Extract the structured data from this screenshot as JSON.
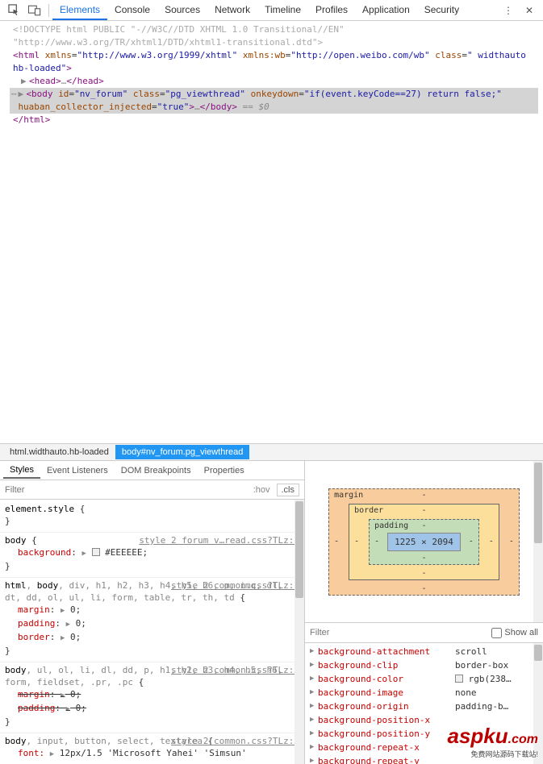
{
  "toolbar": {
    "tabs": [
      "Elements",
      "Console",
      "Sources",
      "Network",
      "Timeline",
      "Profiles",
      "Application",
      "Security"
    ],
    "active_tab": 0
  },
  "dom": {
    "doctype": "<!DOCTYPE html PUBLIC \"-//W3C//DTD XHTML 1.0 Transitional//EN\" \"http://www.w3.org/TR/xhtml1/DTD/xhtml1-transitional.dtd\">",
    "html_attrs": {
      "xmlns": "http://www.w3.org/1999/xhtml",
      "xmlns_wb": "http://open.weibo.com/wb",
      "class": " widthauto hb-loaded"
    },
    "head_open": "<head>",
    "head_close": "</head>",
    "body_attrs": {
      "id": "nv_forum",
      "class": "pg_viewthread",
      "onkeydown": "if(event.keyCode==27) return false;",
      "huaban_collector_injected": "true"
    },
    "body_ellipsis": "…",
    "eq0": "== $0",
    "html_close": "</html>"
  },
  "breadcrumb": {
    "items": [
      "html.widthauto.hb-loaded",
      "body#nv_forum.pg_viewthread"
    ],
    "active": 1
  },
  "subtabs": {
    "items": [
      "Styles",
      "Event Listeners",
      "DOM Breakpoints",
      "Properties"
    ],
    "active": 0
  },
  "styles": {
    "filter_placeholder": "Filter",
    "hov": ":hov",
    "cls": ".cls",
    "rules": [
      {
        "selector_html": "element.style",
        "src": "",
        "props": []
      },
      {
        "selector_html": "body",
        "src": "style 2 forum v…read.css?TLz:1",
        "props": [
          {
            "name": "background",
            "val": "#EEEEEE",
            "swatch": true
          }
        ]
      },
      {
        "selector_html": "html, body, div, h1, h2, h3, h4, h5, h6, p, img, dl, dt, dd, ol, ul, li, form, table, tr, th, td",
        "src": "style 2 common.css?TLz:1",
        "props": [
          {
            "name": "margin",
            "val": "0",
            "arrow": true
          },
          {
            "name": "padding",
            "val": "0",
            "arrow": true
          },
          {
            "name": "border",
            "val": "0",
            "arrow": true
          }
        ]
      },
      {
        "selector_html": "body, ul, ol, li, dl, dd, p, h1, h2, h3, h4, h5, h6, form, fieldset, .pr, .pc",
        "src": "style 2 common.css?TLz:1",
        "props": [
          {
            "name": "margin",
            "val": "0",
            "struck": true,
            "arrow": true
          },
          {
            "name": "padding",
            "val": "0",
            "struck": true,
            "arrow": true
          }
        ]
      },
      {
        "selector_html": "body, input, button, select, textarea",
        "src": "style 2 common.css?TLz:1",
        "props": [
          {
            "name": "font",
            "val": "12px/1.5 'Microsoft Yahei' 'Simsun'",
            "arrow": true,
            "partial": true
          }
        ]
      }
    ]
  },
  "box_model": {
    "margin_label": "margin",
    "border_label": "border",
    "padding_label": "padding",
    "content": "1225 × 2094",
    "dash": "-"
  },
  "computed": {
    "filter_placeholder": "Filter",
    "show_all": "Show all",
    "rows": [
      {
        "name": "background-attachment",
        "val": "scroll"
      },
      {
        "name": "background-clip",
        "val": "border-box"
      },
      {
        "name": "background-color",
        "val": "rgb(238…",
        "swatch": true
      },
      {
        "name": "background-image",
        "val": "none"
      },
      {
        "name": "background-origin",
        "val": "padding-b…"
      },
      {
        "name": "background-position-x",
        "val": ""
      },
      {
        "name": "background-position-y",
        "val": ""
      },
      {
        "name": "background-repeat-x",
        "val": ""
      },
      {
        "name": "background-repeat-y",
        "val": ""
      }
    ]
  },
  "watermark": {
    "main": "aspku",
    "dot": ".com",
    "sub": "免费网站源码下载站!"
  }
}
